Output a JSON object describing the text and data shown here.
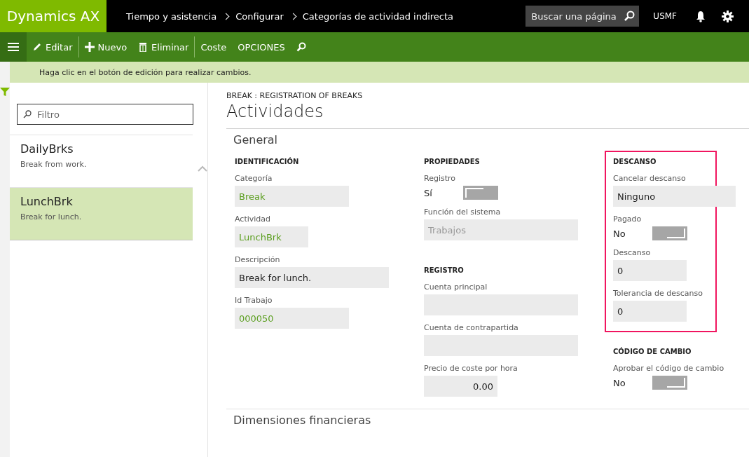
{
  "app": {
    "logo": "Dynamics AX",
    "breadcrumb": [
      "Tiempo y asistencia",
      "Configurar",
      "Categorías de actividad indirecta"
    ],
    "search": {
      "placeholder": "Buscar una página"
    },
    "company": "USMF"
  },
  "toolbar": [
    {
      "kind": "edit",
      "label": "Editar"
    },
    {
      "kind": "divider"
    },
    {
      "kind": "new",
      "label": "Nuevo"
    },
    {
      "kind": "delete",
      "label": "Eliminar"
    },
    {
      "kind": "divider"
    },
    {
      "kind": "plain",
      "label": "Coste"
    },
    {
      "kind": "plain",
      "label": "OPCIONES"
    },
    {
      "kind": "search"
    }
  ],
  "message": "Haga clic en el botón de edición para realizar cambios.",
  "list": {
    "filter": {
      "placeholder": "Filtro"
    },
    "items": [
      {
        "title": "DailyBrks",
        "subtitle": "Break from work.",
        "selected": false
      },
      {
        "title": "LunchBrk",
        "subtitle": "Break for lunch.",
        "selected": true
      }
    ]
  },
  "detail": {
    "caption": "BREAK : REGISTRATION OF BREAKS",
    "title": "Actividades",
    "section": "General",
    "columns": [
      [
        {
          "heading": "IDENTIFICACIÓN",
          "fields": [
            {
              "label": "Categoría",
              "kind": "lookup",
              "value": "Break"
            },
            {
              "label": "Actividad",
              "kind": "lookup",
              "value": "LunchBrk"
            },
            {
              "label": "Descripción",
              "kind": "text",
              "value": "Break for lunch."
            },
            {
              "label": "Id Trabajo",
              "kind": "lookup",
              "value": "000050"
            }
          ]
        }
      ],
      [
        {
          "heading": "PROPIEDADES",
          "fields": [
            {
              "label": "Registro",
              "kind": "toggle",
              "value": "Sí",
              "on": true
            },
            {
              "label": "Función del sistema",
              "kind": "disabled",
              "value": "Trabajos"
            }
          ]
        },
        {
          "heading": "REGISTRO",
          "fields": [
            {
              "label": "Cuenta principal",
              "kind": "text"
            },
            {
              "label": "Cuenta de contrapartida",
              "kind": "text"
            },
            {
              "label": "Precio de coste por hora",
              "kind": "number",
              "value": "0.00"
            }
          ]
        }
      ],
      [
        {
          "heading": "DESCANSO",
          "highlighted": true,
          "fields": [
            {
              "label": "Cancelar descanso",
              "kind": "select",
              "value": "Ninguno"
            },
            {
              "label": "Pagado",
              "kind": "toggle",
              "value": "No",
              "on": false
            },
            {
              "label": "Descanso",
              "kind": "text",
              "value": "0"
            },
            {
              "label": "Tolerancia de descanso",
              "kind": "text",
              "value": "0"
            }
          ]
        },
        {
          "heading": "CÓDIGO DE CAMBIO",
          "fields": [
            {
              "label": "Aprobar el código de cambio",
              "kind": "toggle",
              "value": "No",
              "on": false
            }
          ]
        }
      ]
    ],
    "collapsed_section": "Dimensiones financieras"
  }
}
